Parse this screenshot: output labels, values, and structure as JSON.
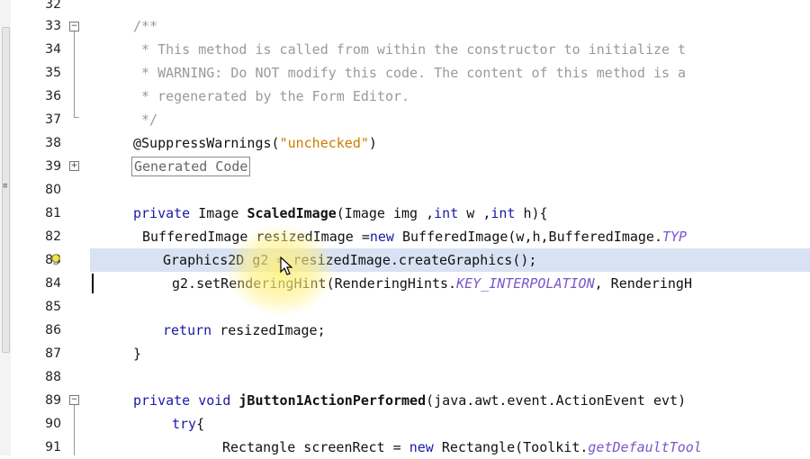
{
  "colors": {
    "keyword": "#1a1aa6",
    "string": "#ce7b00",
    "comment": "#9a9a9a",
    "constant_italic": "#7a56c9",
    "highlight_row": "#d9e2f3",
    "cursor_spotlight": "#fff07a"
  },
  "editor": {
    "lines": [
      {
        "num": "32",
        "text": ""
      },
      {
        "num": "33",
        "text": "/**"
      },
      {
        "num": "34",
        "text": " * This method is called from within the constructor to initialize t"
      },
      {
        "num": "35",
        "text": " * WARNING: Do NOT modify this code. The content of this method is a"
      },
      {
        "num": "36",
        "text": " * regenerated by the Form Editor."
      },
      {
        "num": "37",
        "text": " */"
      },
      {
        "num": "38",
        "text": "@SuppressWarnings(\"unchecked\")"
      },
      {
        "num": "39",
        "text": "Generated Code"
      },
      {
        "num": "80",
        "text": ""
      },
      {
        "num": "81",
        "text": "private Image ScaledImage(Image img ,int w ,int h){"
      },
      {
        "num": "82",
        "text": "BufferedImage resizedImage =new BufferedImage(w,h,BufferedImage.TYP"
      },
      {
        "num": "83",
        "text": "Graphics2D g2 = resizedImage.createGraphics();"
      },
      {
        "num": "84",
        "text": "g2.setRenderingHint(RenderingHints.KEY_INTERPOLATION, RenderingH"
      },
      {
        "num": "85",
        "text": ""
      },
      {
        "num": "86",
        "text": "return resizedImage;"
      },
      {
        "num": "87",
        "text": "}"
      },
      {
        "num": "88",
        "text": ""
      },
      {
        "num": "89",
        "text": "private void jButton1ActionPerformed(java.awt.event.ActionEvent evt)"
      },
      {
        "num": "90",
        "text": "try{"
      },
      {
        "num": "91",
        "text": "Rectangle screenRect = new Rectangle(Toolkit.getDefaultTool"
      }
    ],
    "tokens": {
      "l33": "/**",
      "l34": " * This method is called from within the constructor to initialize t",
      "l35": " * WARNING: Do NOT modify this code. The content of this method is a",
      "l36": " * regenerated by the Form Editor.",
      "l37": " */",
      "l38_a": "@SuppressWarnings(",
      "l38_b": "\"unchecked\"",
      "l38_c": ")",
      "l39": "Generated Code",
      "l81_kw": "private",
      "l81_a": " Image ",
      "l81_b": "ScaledImage",
      "l81_c": "(Image img ,",
      "l81_kw2": "int",
      "l81_d": " w ,",
      "l81_kw3": "int",
      "l81_e": " h){",
      "l82_a": "BufferedImage resizedImage =",
      "l82_kw": "new",
      "l82_b": " BufferedImage(w,h,BufferedImage.",
      "l82_it": "TYP",
      "l83": "Graphics2D g2 = resizedImage.createGraphics();",
      "l84_a": "g2.setRenderingHint(RenderingHints.",
      "l84_it": "KEY_INTERPOLATION",
      "l84_b": ", RenderingH",
      "l86_kw": "return",
      "l86_a": " resizedImage;",
      "l87": "}",
      "l89_kw": "private",
      "l89_kw2": "void",
      "l89_b": "jButton1ActionPerformed",
      "l89_c": "(java.awt.event.ActionEvent evt)",
      "l90_kw": "try",
      "l90_a": "{",
      "l91_a": "Rectangle screenRect = ",
      "l91_kw": "new",
      "l91_b": " Rectangle(Toolkit.",
      "l91_it": "getDefaultTool"
    },
    "left_scrollbar_grip": "≡"
  }
}
